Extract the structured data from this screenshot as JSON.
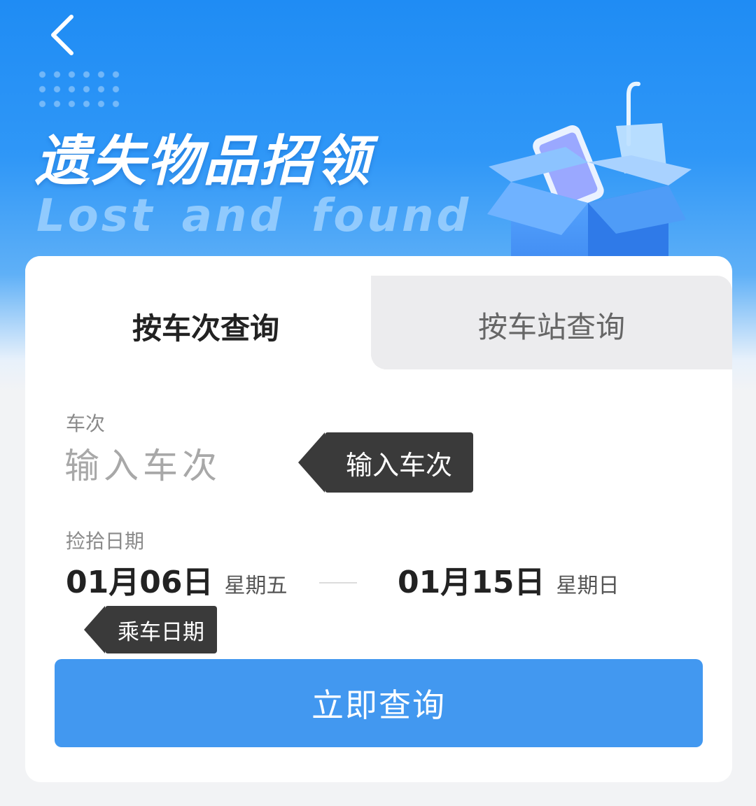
{
  "header": {
    "back_icon": "chevron-left-icon",
    "title_cn": "遗失物品招领",
    "title_en": "Lost and found",
    "illustration": "lost-box-umbrella-phone"
  },
  "tabs": [
    {
      "label": "按车次查询",
      "active": true
    },
    {
      "label": "按车站查询",
      "active": false
    }
  ],
  "form": {
    "train_label": "车次",
    "train_placeholder": "输入车次",
    "train_value": "",
    "date_label": "捡拾日期",
    "date_start": {
      "date": "01月06日",
      "weekday": "星期五"
    },
    "date_end": {
      "date": "01月15日",
      "weekday": "星期日"
    }
  },
  "tooltips": {
    "train": "输入车次",
    "date": "乘车日期"
  },
  "submit_label": "立即查询",
  "colors": {
    "hero_blue": "#2f97f7",
    "button_blue": "#4298f0",
    "tooltip_bg": "#3a3a3a"
  }
}
